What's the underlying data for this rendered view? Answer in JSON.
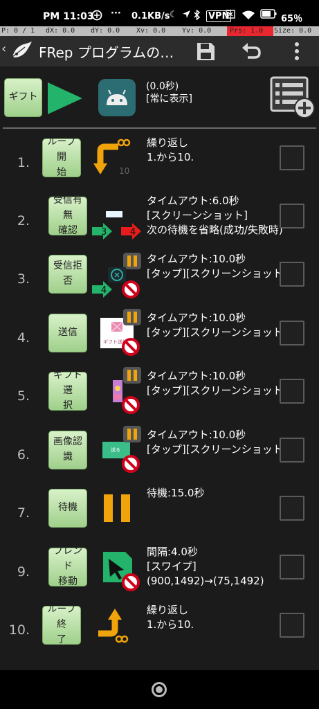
{
  "status_bar": {
    "time": "PM 11:03",
    "dots": "···",
    "speed": "0.1KB/s",
    "vpn": "VPN",
    "battery": "65％"
  },
  "debug_bar": {
    "p": "P: 0 / 1",
    "dx": "dX: 0.0",
    "dy": "dY: 0.0",
    "xv": "Xv: 0.0",
    "yv": "Yv: 0.0",
    "prs": "Prs: 1.0",
    "size": "Size: 0.0",
    "prs_color": "#e8272e"
  },
  "app_bar": {
    "title": "FRep プログラムの…",
    "icons": [
      "back-arrow-icon",
      "app-logo-icon",
      "save-icon",
      "undo-icon",
      "more-vert-icon"
    ]
  },
  "header": {
    "gift_label": "ギフト",
    "time_text": "(0.0秒)",
    "display_text": "[常に表示]",
    "icons": [
      "play-icon",
      "android-icon",
      "list-add-icon"
    ],
    "accent": "#23b36a"
  },
  "steps": [
    {
      "num": "1.",
      "label": "ループ開始",
      "label_lines": [
        "ループ開",
        "始"
      ],
      "lines": [
        "繰り返し",
        "1.から10."
      ],
      "icon": "loop-start-icon",
      "loop_badge": "10"
    },
    {
      "num": "2.",
      "label": "受信有無確認",
      "label_lines": [
        "受信有無",
        "確認"
      ],
      "lines": [
        "タイムアウト:6.0秒",
        "[スクリーンショット]",
        "次の待機を省略(成功/失敗時)"
      ],
      "icon": "image-wait-icon",
      "success_jump": "3",
      "fail_jump": "4"
    },
    {
      "num": "3.",
      "label": "受信拒否",
      "label_lines": [
        "受信拒否"
      ],
      "lines": [
        "タイムアウト:10.0秒",
        "[タップ][スクリーンショット]"
      ],
      "icon": "image-tap-icon",
      "success_jump": "4"
    },
    {
      "num": "4.",
      "label": "送信",
      "label_lines": [
        "送信"
      ],
      "lines": [
        "タイムアウト:10.0秒",
        "[タップ][スクリーンショット]"
      ],
      "icon": "image-tap-icon",
      "thumb_text": "ギフト送信"
    },
    {
      "num": "5.",
      "label": "ギフト選択",
      "label_lines": [
        "ギフト選",
        "択"
      ],
      "lines": [
        "タイムアウト:10.0秒",
        "[タップ][スクリーンショット]"
      ],
      "icon": "image-tap-icon"
    },
    {
      "num": "6.",
      "label": "画像認識",
      "label_lines": [
        "画像認識"
      ],
      "lines": [
        "タイムアウト:10.0秒",
        "[タップ][スクリーンショット]"
      ],
      "icon": "image-tap-icon",
      "thumb_text": "送る"
    },
    {
      "num": "7.",
      "label": "待機",
      "label_lines": [
        "待機"
      ],
      "lines": [
        "待機:15.0秒"
      ],
      "icon": "pause-icon"
    },
    {
      "num": "9.",
      "label": "フレンド移動",
      "label_lines": [
        "フレンド",
        "移動"
      ],
      "lines": [
        "間隔:4.0秒",
        "[スワイプ]",
        "(900,1492)→(75,1492)"
      ],
      "icon": "swipe-icon"
    },
    {
      "num": "10.",
      "label": "ループ終了",
      "label_lines": [
        "ループ終",
        "了"
      ],
      "lines": [
        "繰り返し",
        "1.から10."
      ],
      "icon": "loop-end-icon"
    }
  ],
  "colors": {
    "button_top": "#d8f1c8",
    "button_bottom": "#9fd08b",
    "pause_orange": "#f0a30a",
    "no_red": "#d0021b",
    "jump_green": "#23b36a",
    "jump_red": "#e81c1c"
  }
}
